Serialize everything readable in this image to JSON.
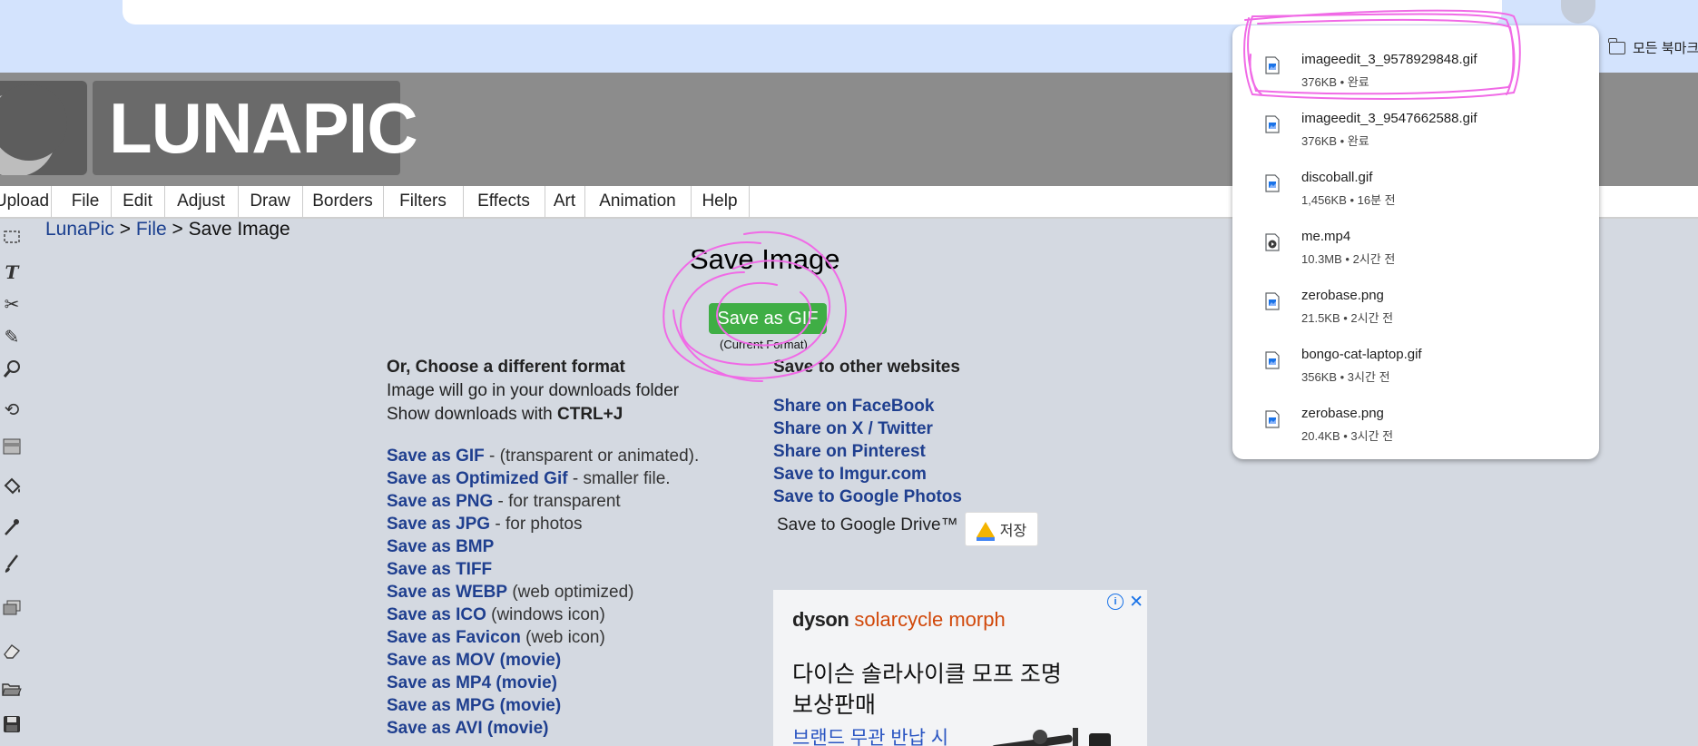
{
  "browser": {
    "bookmarks_label": "모든 북마크"
  },
  "logo": {
    "text": "LUNAPIC"
  },
  "menu": [
    "Upload",
    "File",
    "Edit",
    "Adjust",
    "Draw",
    "Borders",
    "Filters",
    "Effects",
    "Art",
    "Animation",
    "Help"
  ],
  "tools": [
    "select-tool-icon",
    "text-tool-icon",
    "scissors-icon",
    "pencil-icon",
    "magnifier-icon",
    "rotate-icon",
    "gradient-icon",
    "paint-bucket-icon",
    "eyedropper-icon",
    "brush-icon",
    "layers-icon",
    "eraser-icon",
    "open-folder-icon",
    "save-disk-icon"
  ],
  "breadcrumb": {
    "home": "LunaPic",
    "sep1": ">",
    "section": "File",
    "sep2": ">",
    "current": "Save Image"
  },
  "page": {
    "title": "Save Image",
    "primary_button": "Save as GIF",
    "current_format": "(Current Format)"
  },
  "formats": {
    "heading": "Or, Choose a different format",
    "line1": "Image will go in your downloads folder",
    "line2_pre": "Show downloads with ",
    "line2_key": "CTRL+J",
    "items": [
      {
        "link": "Save as GIF",
        "desc": " - (transparent or animated)."
      },
      {
        "link": "Save as Optimized Gif",
        "desc": " - smaller file."
      },
      {
        "link": "Save as PNG",
        "desc": " - for transparent"
      },
      {
        "link": "Save as JPG",
        "desc": " - for photos"
      },
      {
        "link": "Save as BMP",
        "desc": ""
      },
      {
        "link": "Save as TIFF",
        "desc": ""
      },
      {
        "link": "Save as WEBP",
        "desc": " (web optimized)"
      },
      {
        "link": "Save as ICO",
        "desc": " (windows icon)"
      },
      {
        "link": "Save as Favicon",
        "desc": " (web icon)"
      },
      {
        "link": "Save as MOV (movie)",
        "desc": ""
      },
      {
        "link": "Save as MP4 (movie)",
        "desc": ""
      },
      {
        "link": "Save as MPG (movie)",
        "desc": ""
      },
      {
        "link": "Save as AVI (movie)",
        "desc": ""
      }
    ]
  },
  "share": {
    "heading": "Save to other websites",
    "links": [
      "Share on FaceBook",
      "Share on X / Twitter",
      "Share on Pinterest",
      "Save to Imgur.com",
      "Save to Google Photos"
    ],
    "gdrive_label": "Save to Google Drive™",
    "gdrive_button": "저장"
  },
  "ad": {
    "brand": "dyson",
    "product": "solarcycle morph",
    "headline1": "다이슨 솔라사이클 모프 조명",
    "headline2": "보상판매",
    "sub": "브랜드 무관 반납 시"
  },
  "downloads": [
    {
      "name": "imageedit_3_9578929848.gif",
      "meta": "376KB • 완료",
      "type": "image"
    },
    {
      "name": "imageedit_3_9547662588.gif",
      "meta": "376KB • 완료",
      "type": "image"
    },
    {
      "name": "discoball.gif",
      "meta": "1,456KB • 16분 전",
      "type": "image"
    },
    {
      "name": "me.mp4",
      "meta": "10.3MB • 2시간 전",
      "type": "video"
    },
    {
      "name": "zerobase.png",
      "meta": "21.5KB • 2시간 전",
      "type": "image"
    },
    {
      "name": "bongo-cat-laptop.gif",
      "meta": "356KB • 3시간 전",
      "type": "image"
    },
    {
      "name": "zerobase.png",
      "meta": "20.4KB • 3시간 전",
      "type": "image"
    }
  ],
  "colors": {
    "annotation": "#f06ae6",
    "link": "#1f3f8f",
    "button": "#3fae45",
    "chrome": "#d3e3fd"
  }
}
